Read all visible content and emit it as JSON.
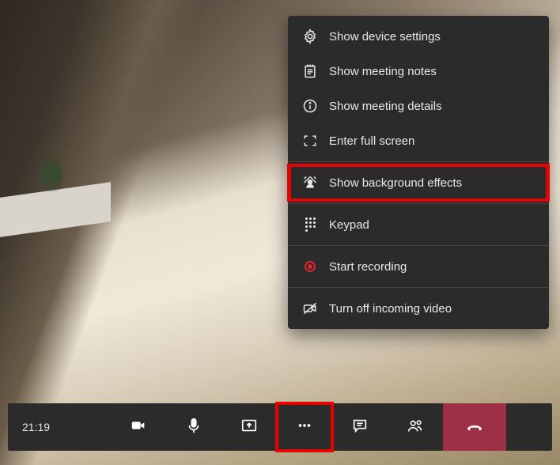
{
  "toolbar": {
    "timer": "21:19"
  },
  "menu": {
    "device_settings": "Show device settings",
    "meeting_notes": "Show meeting notes",
    "meeting_details": "Show meeting details",
    "full_screen": "Enter full screen",
    "background_effects": "Show background effects",
    "keypad": "Keypad",
    "start_recording": "Start recording",
    "turn_off_incoming": "Turn off incoming video"
  }
}
